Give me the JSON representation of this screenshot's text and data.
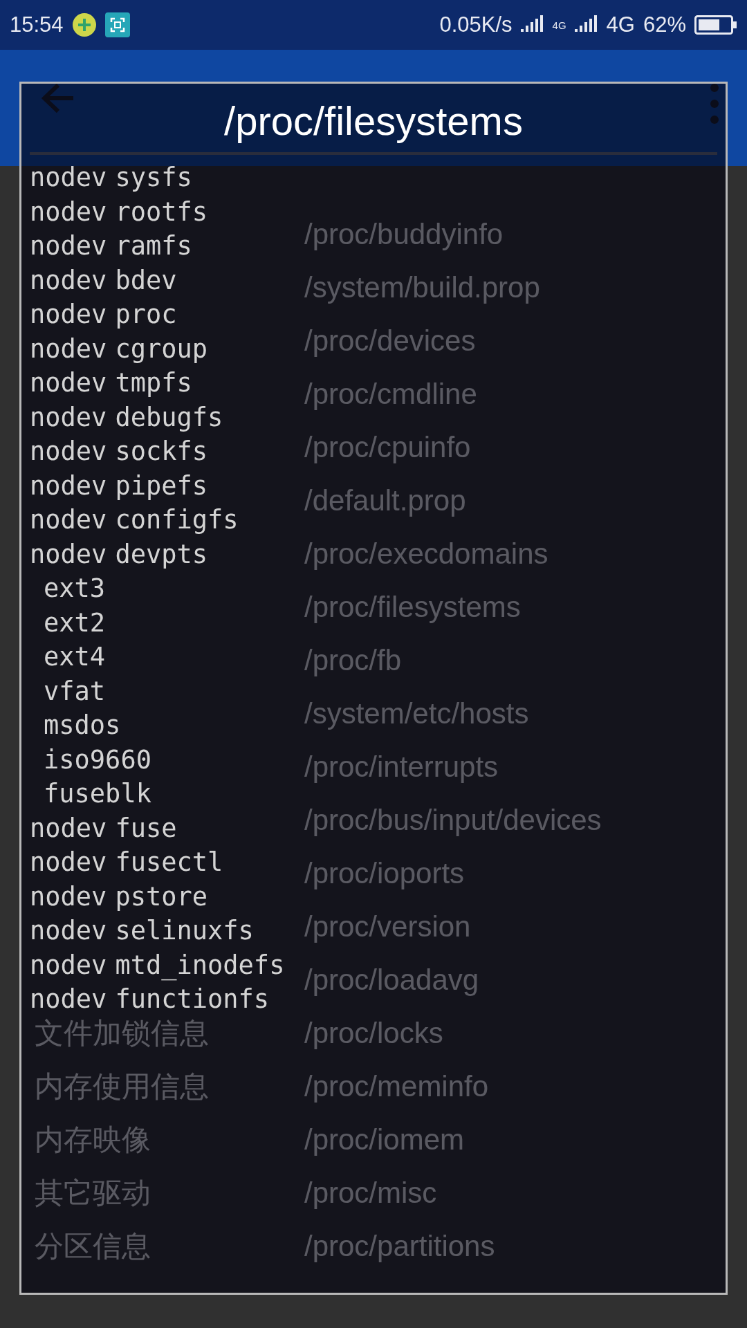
{
  "status_bar": {
    "time": "15:54",
    "speed": "0.05K/s",
    "sim_label": "4G",
    "network": "4G",
    "battery": "62%"
  },
  "background_list": [
    {
      "path": "/proc/buddyinfo"
    },
    {
      "path": "/system/build.prop"
    },
    {
      "path": "/proc/devices"
    },
    {
      "path": "/proc/cmdline"
    },
    {
      "path": "/proc/cpuinfo"
    },
    {
      "path": "/default.prop"
    },
    {
      "path": "/proc/execdomains"
    },
    {
      "path": "/proc/filesystems"
    },
    {
      "path": "/proc/fb"
    },
    {
      "path": "/system/etc/hosts"
    },
    {
      "path": "/proc/interrupts"
    },
    {
      "path": "/proc/bus/input/devices"
    },
    {
      "path": "/proc/ioports"
    },
    {
      "path": "/proc/version"
    },
    {
      "path": "/proc/loadavg"
    },
    {
      "label": "文件加锁信息",
      "path": "/proc/locks"
    },
    {
      "label": "内存使用信息",
      "path": "/proc/meminfo"
    },
    {
      "label": "内存映像",
      "path": "/proc/iomem"
    },
    {
      "label": "其它驱动",
      "path": "/proc/misc"
    },
    {
      "label": "分区信息",
      "path": "/proc/partitions"
    }
  ],
  "dialog": {
    "title": "/proc/filesystems",
    "lines": [
      {
        "column_1": "nodev",
        "column_2": "sysfs"
      },
      {
        "column_1": "nodev",
        "column_2": "rootfs"
      },
      {
        "column_1": "nodev",
        "column_2": "ramfs"
      },
      {
        "column_1": "nodev",
        "column_2": "bdev"
      },
      {
        "column_1": "nodev",
        "column_2": "proc"
      },
      {
        "column_1": "nodev",
        "column_2": "cgroup"
      },
      {
        "column_1": "nodev",
        "column_2": "tmpfs"
      },
      {
        "column_1": "nodev",
        "column_2": "debugfs"
      },
      {
        "column_1": "nodev",
        "column_2": "sockfs"
      },
      {
        "column_1": "nodev",
        "column_2": "pipefs"
      },
      {
        "column_1": "nodev",
        "column_2": "configfs"
      },
      {
        "column_1": "nodev",
        "column_2": "devpts"
      },
      {
        "column_2": "ext3"
      },
      {
        "column_2": "ext2"
      },
      {
        "column_2": "ext4"
      },
      {
        "column_2": "vfat"
      },
      {
        "column_2": "msdos"
      },
      {
        "column_2": "iso9660"
      },
      {
        "column_2": "fuseblk"
      },
      {
        "column_1": "nodev",
        "column_2": "fuse"
      },
      {
        "column_1": "nodev",
        "column_2": "fusectl"
      },
      {
        "column_1": "nodev",
        "column_2": "pstore"
      },
      {
        "column_1": "nodev",
        "column_2": "selinuxfs"
      },
      {
        "column_1": "nodev",
        "column_2": "mtd_inodefs"
      },
      {
        "column_1": "nodev",
        "column_2": "functionfs"
      }
    ]
  }
}
